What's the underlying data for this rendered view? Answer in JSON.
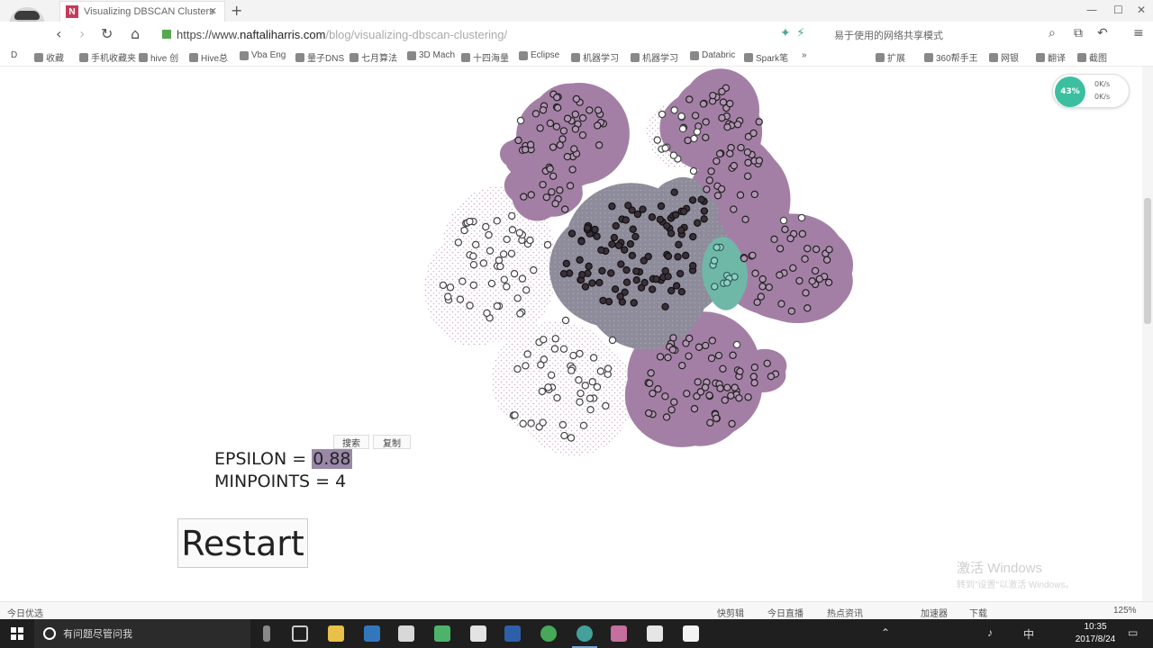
{
  "browser": {
    "tab_title": "Visualizing DBSCAN Clusters",
    "favicon_letter": "N",
    "url_scheme": "https://www.",
    "url_host": "naftaliharris.com",
    "url_path": "/blog/visualizing-dbscan-clustering/",
    "search_text": "易于使用的网络共享模式",
    "bookmarks": [
      "收藏",
      "手机收藏夹",
      "hive 创",
      "Hive总",
      "Vba Eng",
      "量子DNS",
      "七月算法",
      "3D Mach",
      "十四海量",
      "Eclipse",
      "机器学习",
      "机器学习",
      "Databric",
      "Spark笔",
      "扩展",
      "360帮手王",
      "网银",
      "翻译",
      "截图"
    ]
  },
  "net_widget": {
    "percent": "43%",
    "up": "0K/s",
    "down": "0K/s"
  },
  "params": {
    "epsilon_label": "EPSILON = ",
    "epsilon_value": "0.88",
    "minpoints_label": "MINPOINTS = ",
    "minpoints_value": "4"
  },
  "popup": {
    "search": "搜索",
    "copy": "复制"
  },
  "restart_label": "Restart",
  "watermark": {
    "line1": "激活 Windows",
    "line2": "转到\"设置\"以激活 Windows。"
  },
  "statusbar": {
    "left": "今日优选",
    "items": [
      "快剪辑",
      "今日直播",
      "热点资讯",
      "加速器",
      "下载"
    ],
    "zoom": "125%"
  },
  "taskbar": {
    "search_placeholder": "有问题尽管问我",
    "time": "10:35",
    "date": "2017/8/24",
    "ime": "中"
  },
  "colors": {
    "cluster_purple": "#a37fa5",
    "core_cluster": "#8a8a96",
    "teal_cluster": "#6fb8a8",
    "noise_speckle": "#e6d6e4"
  },
  "cluster_labels": [
    "top-left",
    "small-left",
    "top-right",
    "center",
    "teal",
    "right",
    "bottom",
    "noise-left",
    "noise-bottom",
    "noise-top"
  ]
}
